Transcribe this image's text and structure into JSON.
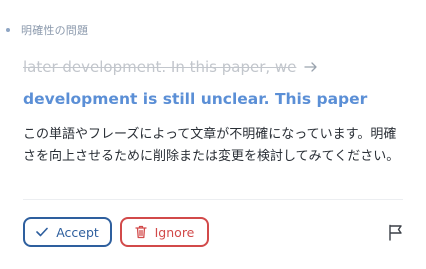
{
  "header": {
    "category": "明確性の問題"
  },
  "correction": {
    "original": "later development. In this paper, we",
    "suggestion": "development is still unclear. This paper"
  },
  "explanation": "この単語やフレーズによって文章が不明確になっています。明確さを向上させるために削除または変更を検討してみてください。",
  "actions": {
    "accept_label": "Accept",
    "ignore_label": "Ignore"
  },
  "icons": {
    "bullet": "dot-icon",
    "arrow": "arrow-right-icon",
    "accept": "check-icon",
    "ignore": "trash-icon",
    "flag": "flag-icon"
  },
  "colors": {
    "suggestion": "#5b8fd6",
    "accept": "#2e5f9e",
    "ignore": "#d24a4a",
    "strikethrough": "#c2c6cc"
  }
}
